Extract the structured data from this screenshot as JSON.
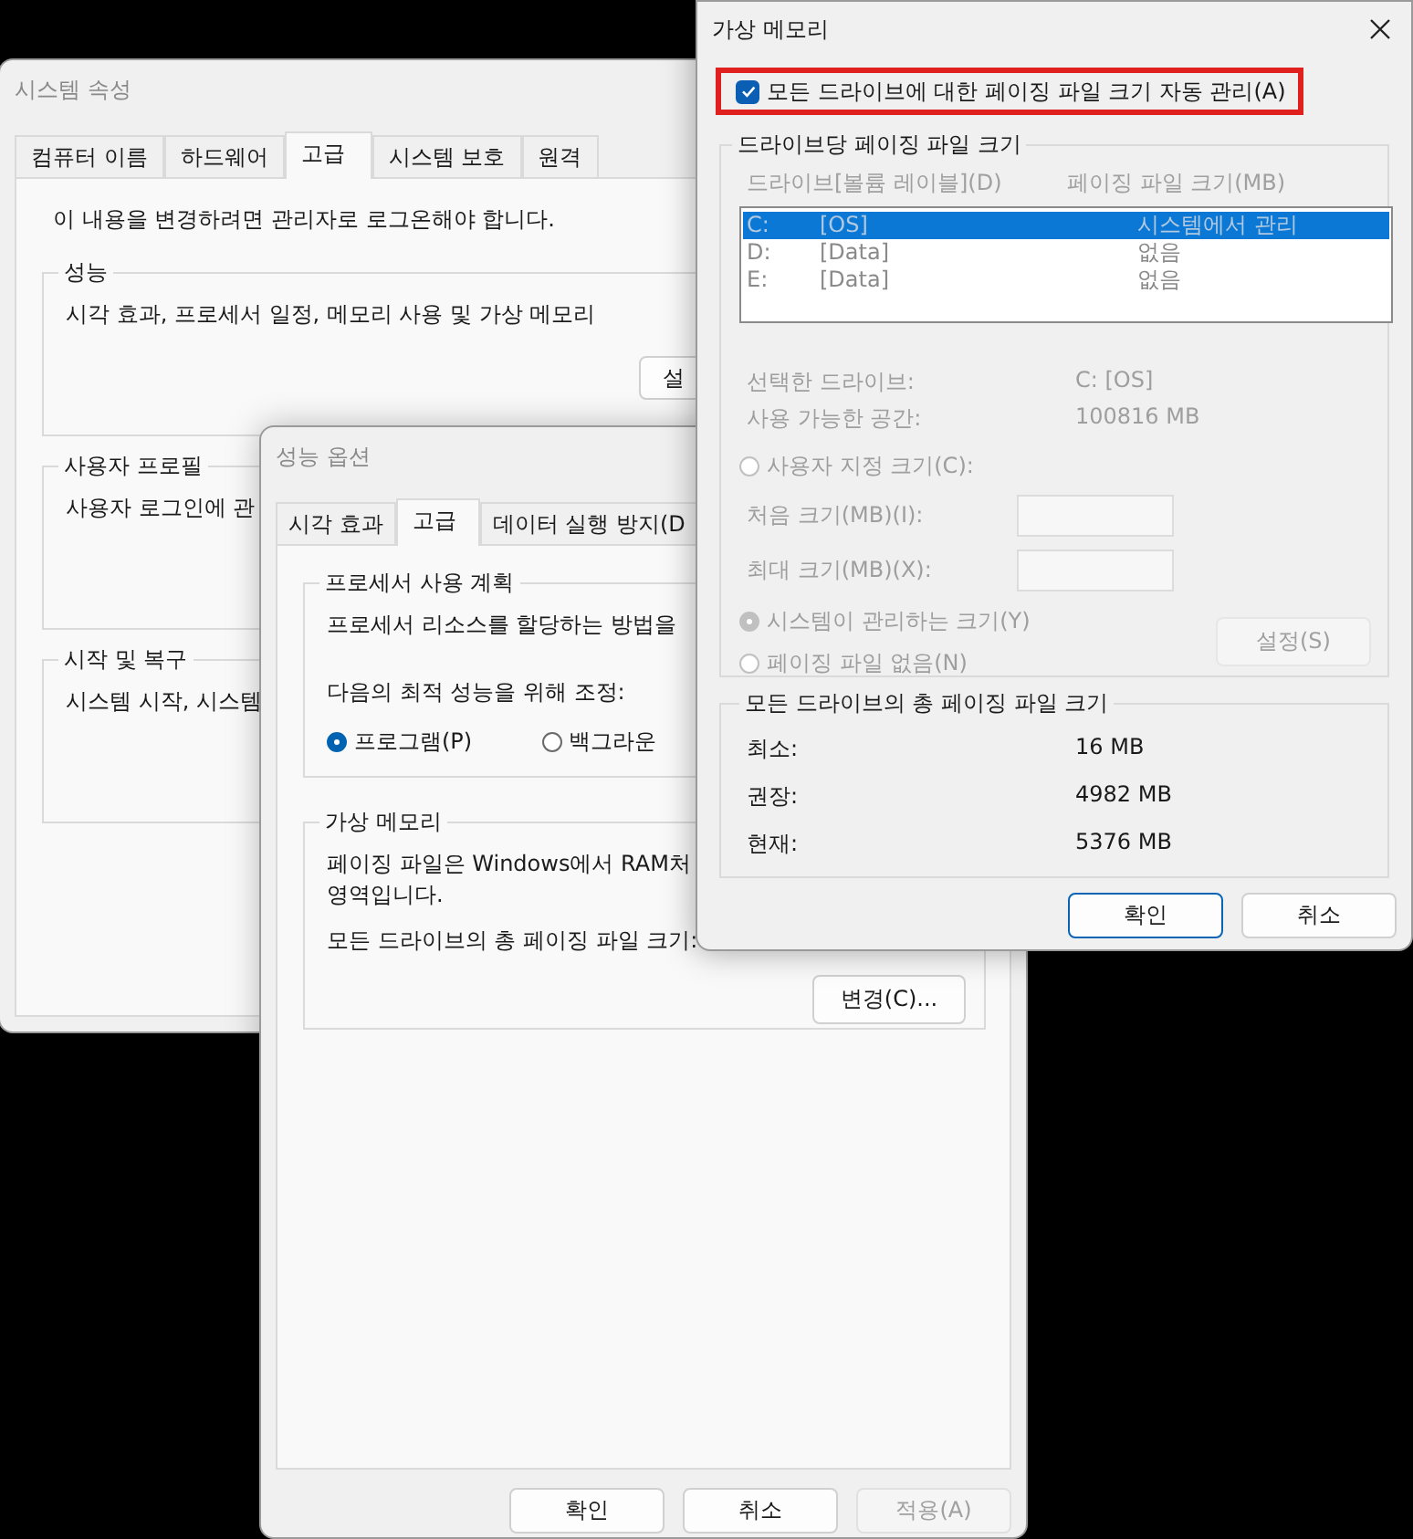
{
  "system_properties": {
    "title": "시스템 속성",
    "tabs": [
      {
        "label": "컴퓨터 이름",
        "selected": false
      },
      {
        "label": "하드웨어",
        "selected": false
      },
      {
        "label": "고급",
        "selected": true
      },
      {
        "label": "시스템 보호",
        "selected": false
      },
      {
        "label": "원격",
        "selected": false
      }
    ],
    "notice": "이 내용을 변경하려면 관리자로 로그온해야 합니다.",
    "groups": [
      {
        "label": "성능",
        "description": "시각 효과, 프로세서 일정, 메모리 사용 및 가상 메모리",
        "button": "설"
      },
      {
        "label": "사용자 프로필",
        "description": "사용자 로그인에 관"
      },
      {
        "label": "시작 및 복구",
        "description": "시스템 시작, 시스템"
      }
    ]
  },
  "performance_options": {
    "title": "성능 옵션",
    "tabs": [
      {
        "label": "시각 효과",
        "selected": false
      },
      {
        "label": "고급",
        "selected": true
      },
      {
        "label": "데이터 실행 방지(D",
        "selected": false
      }
    ],
    "processor_scheduling": {
      "label": "프로세서 사용 계획",
      "description": "프로세서 리소스를 할당하는 방법을",
      "adjust_label": "다음의 최적 성능을 위해 조정:",
      "options": [
        {
          "label": "프로그램(P)",
          "selected": true
        },
        {
          "label": "백그라운",
          "selected": false
        }
      ]
    },
    "virtual_memory": {
      "label": "가상 메모리",
      "description_lines": [
        "페이징 파일은 Windows에서 RAM처",
        "영역입니다."
      ],
      "total_label": "모든 드라이브의 총 페이징 파일 크기:",
      "button": "변경(C)..."
    },
    "buttons": [
      {
        "label": "확인",
        "disabled": false
      },
      {
        "label": "취소",
        "disabled": false
      },
      {
        "label": "적용(A)",
        "disabled": true
      }
    ]
  },
  "virtual_memory": {
    "title": "가상 메모리",
    "auto_manage": {
      "label": "모든 드라이브에 대한 페이징 파일 크기 자동 관리(A)",
      "checked": true,
      "highlighted": true
    },
    "per_drive": {
      "label": "드라이브당 페이징 파일 크기",
      "disabled": true,
      "columns": [
        "드라이브[볼륨 레이블](D)",
        "페이징 파일 크기(MB)"
      ],
      "drives": [
        {
          "drive": "C:",
          "volume": "[OS]",
          "size": "시스템에서 관리",
          "selected": true
        },
        {
          "drive": "D:",
          "volume": "[Data]",
          "size": "없음",
          "selected": false
        },
        {
          "drive": "E:",
          "volume": "[Data]",
          "size": "없음",
          "selected": false
        }
      ],
      "info": [
        {
          "label": "선택한 드라이브:",
          "value": "C:  [OS]"
        },
        {
          "label": "사용 가능한 공간:",
          "value": "100816 MB"
        }
      ],
      "custom": {
        "label": "사용자 지정 크기(C):",
        "selected": false
      },
      "fields": [
        {
          "label": "처음 크기(MB)(I):"
        },
        {
          "label": "최대 크기(MB)(X):"
        }
      ],
      "size_options": [
        {
          "label": "시스템이 관리하는 크기(Y)",
          "selected": true
        },
        {
          "label": "페이징 파일 없음(N)",
          "selected": false
        }
      ],
      "set_button": "설정(S)"
    },
    "totals": {
      "label": "모든 드라이브의 총 페이징 파일 크기",
      "rows": [
        {
          "label": "최소:",
          "value": "16 MB"
        },
        {
          "label": "권장:",
          "value": "4982 MB"
        },
        {
          "label": "현재:",
          "value": "5376 MB"
        }
      ]
    },
    "buttons": [
      {
        "label": "확인",
        "default": true
      },
      {
        "label": "취소",
        "default": false
      }
    ]
  }
}
